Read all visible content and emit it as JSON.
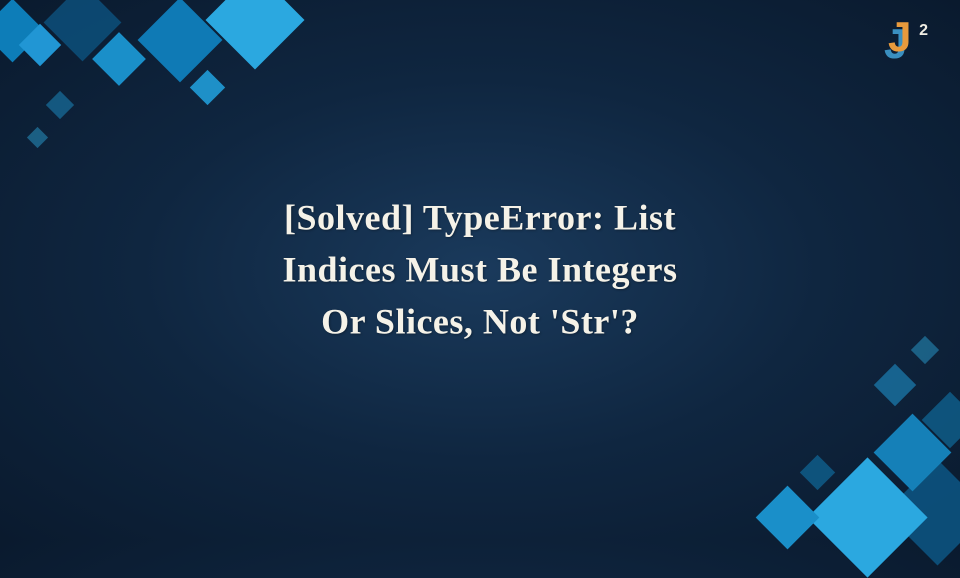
{
  "logo": {
    "letter": "J",
    "superscript": "2"
  },
  "title": {
    "line1": "[Solved] TypeError: List",
    "line2": "Indices Must Be Integers",
    "line3": "Or Slices, Not 'Str'?"
  },
  "colors": {
    "background_center": "#1a3a5c",
    "background_edge": "#0a1a2e",
    "accent_blue_light": "#2ba8e0",
    "accent_blue_dark": "#0d5a8a",
    "text": "#f5f2e8",
    "logo_orange": "#e89a3c",
    "logo_blue": "#3a8fc0"
  }
}
